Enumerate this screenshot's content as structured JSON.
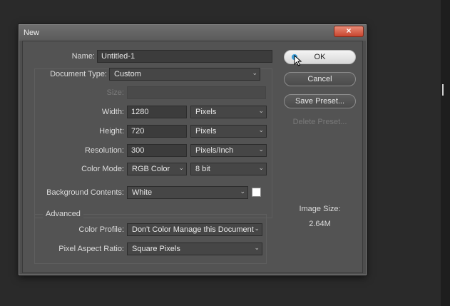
{
  "dialog": {
    "title": "New",
    "close_label": "×"
  },
  "form": {
    "name_label": "Name:",
    "name_value": "Untitled-1",
    "doc_type_label": "Document Type:",
    "doc_type_value": "Custom",
    "size_label": "Size:",
    "width_label": "Width:",
    "width_value": "1280",
    "width_unit": "Pixels",
    "height_label": "Height:",
    "height_value": "720",
    "height_unit": "Pixels",
    "resolution_label": "Resolution:",
    "resolution_value": "300",
    "resolution_unit": "Pixels/Inch",
    "color_mode_label": "Color Mode:",
    "color_mode_value": "RGB Color",
    "bit_depth_value": "8 bit",
    "bg_label": "Background Contents:",
    "bg_value": "White",
    "bg_swatch_color": "#ffffff",
    "advanced_label": "Advanced",
    "color_profile_label": "Color Profile:",
    "color_profile_value": "Don't Color Manage this Document",
    "par_label": "Pixel Aspect Ratio:",
    "par_value": "Square Pixels"
  },
  "buttons": {
    "ok": "OK",
    "cancel": "Cancel",
    "save_preset": "Save Preset...",
    "delete_preset": "Delete Preset..."
  },
  "image_size": {
    "label": "Image Size:",
    "value": "2.64M"
  },
  "icons": {
    "dropdown": "chevron-down-icon",
    "close": "close-icon",
    "cursor": "mouse-cursor-icon"
  }
}
